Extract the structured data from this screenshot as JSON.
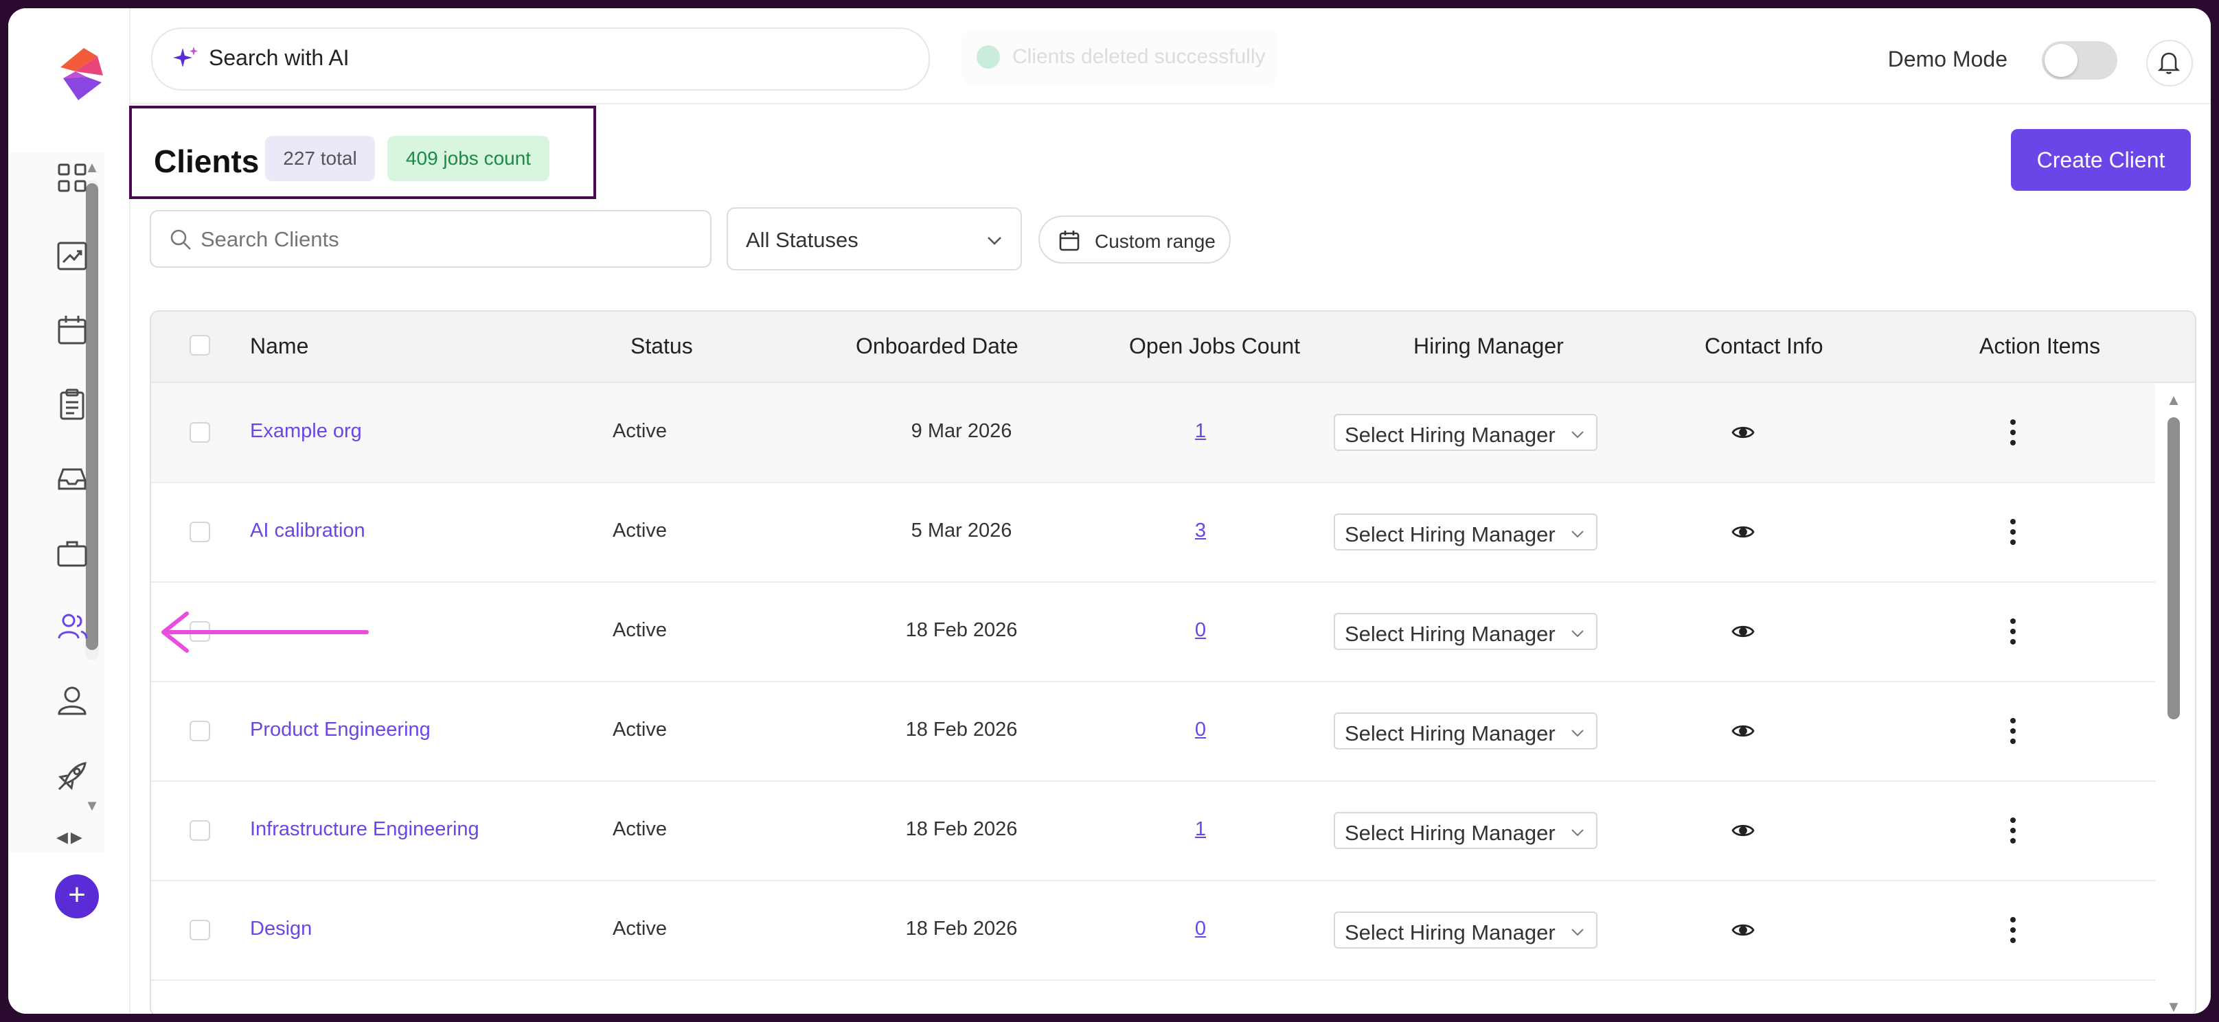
{
  "app": {
    "accent_color": "#6a45e8",
    "logo_icon": "app-logo"
  },
  "sidebar": {
    "items": [
      {
        "icon": "dashboard-grid-icon"
      },
      {
        "icon": "analytics-chart-icon"
      },
      {
        "icon": "calendar-icon"
      },
      {
        "icon": "clipboard-icon"
      },
      {
        "icon": "inbox-icon"
      },
      {
        "icon": "briefcase-icon"
      },
      {
        "icon": "clients-users-icon"
      },
      {
        "icon": "user-icon"
      },
      {
        "icon": "rocket-icon"
      }
    ],
    "add_label": "+"
  },
  "topbar": {
    "search_label": "Search with AI",
    "toast_message": "Clients deleted successfully",
    "demo_mode_label": "Demo Mode",
    "demo_mode_on": false
  },
  "header": {
    "title": "Clients",
    "total_badge": "227 total",
    "jobs_badge": "409 jobs count",
    "create_button": "Create Client"
  },
  "filters": {
    "search_placeholder": "Search Clients",
    "status_value": "All Statuses",
    "date_range_label": "Custom range"
  },
  "table": {
    "columns": [
      "Name",
      "Status",
      "Onboarded Date",
      "Open Jobs Count",
      "Hiring Manager",
      "Contact Info",
      "Action Items"
    ],
    "rows": [
      {
        "name": "Example org",
        "status": "Active",
        "date": "9 Mar 2026",
        "jobs": "1",
        "hiring_manager": "Select Hiring Manager"
      },
      {
        "name": "AI calibration",
        "status": "Active",
        "date": "5 Mar 2026",
        "jobs": "3",
        "hiring_manager": "Select Hiring Manager"
      },
      {
        "name": "",
        "status": "Active",
        "date": "18 Feb 2026",
        "jobs": "0",
        "hiring_manager": "Select Hiring Manager"
      },
      {
        "name": "Product Engineering",
        "status": "Active",
        "date": "18 Feb 2026",
        "jobs": "0",
        "hiring_manager": "Select Hiring Manager"
      },
      {
        "name": "Infrastructure Engineering",
        "status": "Active",
        "date": "18 Feb 2026",
        "jobs": "1",
        "hiring_manager": "Select Hiring Manager"
      },
      {
        "name": "Design",
        "status": "Active",
        "date": "18 Feb 2026",
        "jobs": "0",
        "hiring_manager": "Select Hiring Manager"
      }
    ]
  },
  "annotation": {
    "arrow_color": "#e84de0",
    "highlight_color": "#4a0a52"
  }
}
